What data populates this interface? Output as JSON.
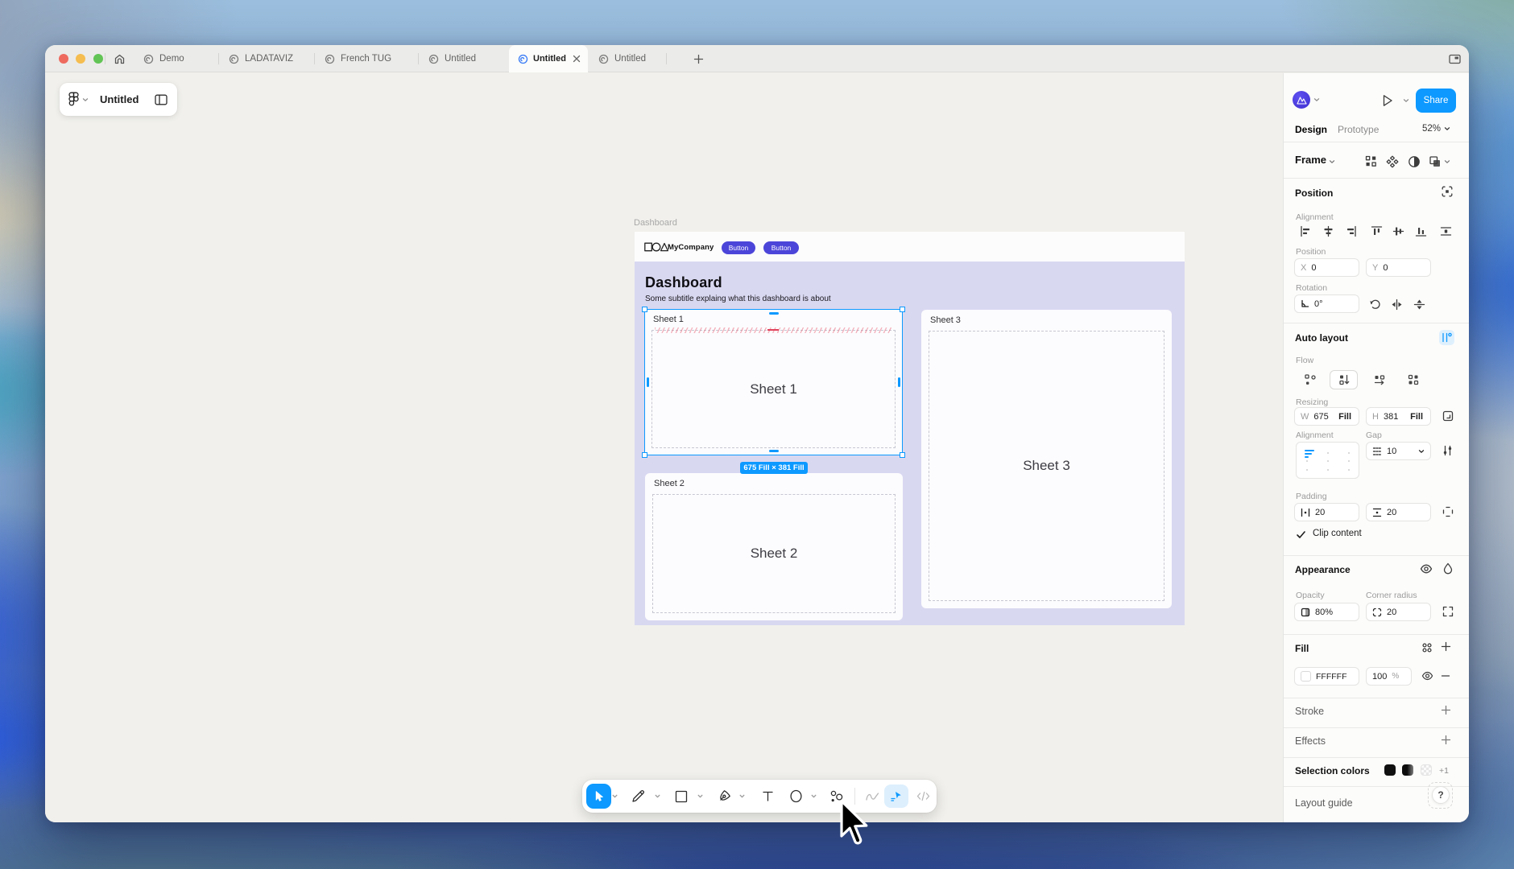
{
  "window": {
    "tabs": [
      {
        "label": "Demo",
        "active": false
      },
      {
        "label": "LADATAVIZ",
        "active": false
      },
      {
        "label": "French TUG",
        "active": false
      },
      {
        "label": "Untitled",
        "active": false
      },
      {
        "label": "Untitled",
        "active": true
      },
      {
        "label": "Untitled",
        "active": false
      }
    ]
  },
  "file_pill": {
    "title": "Untitled"
  },
  "canvas": {
    "frame_label": "Dashboard",
    "size_badge": "675 Fill × 381 Fill",
    "design": {
      "company": "MyCompany",
      "nav_buttons": [
        "Button",
        "Button"
      ],
      "title": "Dashboard",
      "subtitle": "Some subtitle explaing what this dashboard is about",
      "sheets": [
        {
          "label": "Sheet 1",
          "center": "Sheet 1"
        },
        {
          "label": "Sheet 2",
          "center": "Sheet 2"
        },
        {
          "label": "Sheet 3",
          "center": "Sheet 3"
        }
      ]
    }
  },
  "inspector": {
    "share_label": "Share",
    "tab_design": "Design",
    "tab_prototype": "Prototype",
    "zoom": "52%",
    "frame_preset": "Frame",
    "position": {
      "header": "Position",
      "alignment_label": "Alignment",
      "position_label": "Position",
      "x_label": "X",
      "x_value": "0",
      "y_label": "Y",
      "y_value": "0",
      "rotation_label": "Rotation",
      "rotation_value": "0°"
    },
    "auto_layout": {
      "header": "Auto layout",
      "flow_label": "Flow",
      "resizing_label": "Resizing",
      "w_label": "W",
      "w_value": "675",
      "w_fill": "Fill",
      "h_label": "H",
      "h_value": "381",
      "h_fill": "Fill",
      "alignment_label": "Alignment",
      "gap_label": "Gap",
      "gap_value": "10",
      "padding_label": "Padding",
      "padding_h": "20",
      "padding_v": "20",
      "clip_label": "Clip content"
    },
    "appearance": {
      "header": "Appearance",
      "opacity_label": "Opacity",
      "opacity_value": "80%",
      "radius_label": "Corner radius",
      "radius_value": "20"
    },
    "fill": {
      "header": "Fill",
      "hex": "FFFFFF",
      "opacity": "100",
      "percent": "%"
    },
    "stroke": {
      "header": "Stroke"
    },
    "effects": {
      "header": "Effects"
    },
    "selection_colors": {
      "header": "Selection colors",
      "more": "+1"
    },
    "layout_guide": {
      "header": "Layout guide"
    },
    "help": "?"
  },
  "colors": {
    "accent_blue": "#0d99ff",
    "button_indigo": "#4c45d9",
    "frame_body_lavender": "#d9d8f1",
    "canvas_gray": "#f1f0ec",
    "fill_hex": "#FFFFFF"
  }
}
